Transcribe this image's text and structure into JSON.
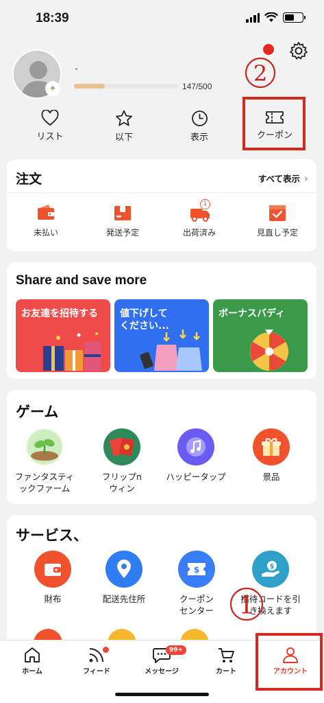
{
  "status_bar": {
    "time": "18:39"
  },
  "profile": {
    "progress_text": "147/500",
    "progress_fraction": 0.294
  },
  "quick_actions": [
    {
      "label": "リスト",
      "icon": "heart-icon"
    },
    {
      "label": "以下",
      "icon": "star-icon"
    },
    {
      "label": "表示",
      "icon": "clock-icon"
    },
    {
      "label": "クーポン",
      "icon": "ticket-icon"
    }
  ],
  "annotations": {
    "marker_1": "1",
    "marker_2": "2",
    "color": "#d42a1e"
  },
  "orders": {
    "title": "注文",
    "view_all": "すべて表示",
    "items": [
      {
        "label": "未払い",
        "icon": "wallet-icon"
      },
      {
        "label": "発送予定",
        "icon": "package-icon"
      },
      {
        "label": "出荷済み",
        "icon": "truck-icon",
        "badge": "1"
      },
      {
        "label": "見直し予定",
        "icon": "review-icon"
      }
    ]
  },
  "share": {
    "title": "Share and save more",
    "promos": [
      {
        "text": "お友達を招待する",
        "color": "#ef4b4b"
      },
      {
        "text_line1": "値下げして",
        "text_line2": "ください...",
        "color": "#2f6ff0"
      },
      {
        "text": "ボーナスバディ",
        "color": "#3a9a4a"
      }
    ]
  },
  "games": {
    "title": "ゲーム",
    "items": [
      {
        "line1": "ファンタスティ",
        "line2": "ックファーム",
        "icon": "sprout-icon"
      },
      {
        "line1": "フリップn",
        "line2": "ウィン",
        "icon": "cards-icon"
      },
      {
        "line1": "ハッピータップ",
        "line2": "",
        "icon": "music-icon"
      },
      {
        "line1": "景品",
        "line2": "",
        "icon": "gift-icon"
      }
    ]
  },
  "services": {
    "title": "サービス、",
    "items": [
      {
        "line1": "財布",
        "line2": "",
        "icon": "wallet-icon"
      },
      {
        "line1": "配送先住所",
        "line2": "",
        "icon": "location-icon"
      },
      {
        "line1": "クーポン",
        "line2": "センター",
        "icon": "coupon-center-icon"
      },
      {
        "line1": "招待コードを引",
        "line2": "き換えます",
        "icon": "hand-coin-icon"
      }
    ]
  },
  "tabbar": [
    {
      "label": "ホーム",
      "icon": "home-icon"
    },
    {
      "label": "フィード",
      "icon": "feed-icon"
    },
    {
      "label": "メッセージ",
      "icon": "chat-icon",
      "badge": "99+"
    },
    {
      "label": "カート",
      "icon": "cart-icon"
    },
    {
      "label": "アカウント",
      "icon": "person-icon",
      "active": true
    }
  ],
  "colors": {
    "accent": "#e43a2a",
    "promo_red": "#ef4b4b",
    "promo_blue": "#2f6ff0",
    "promo_green": "#3a9a4a"
  }
}
